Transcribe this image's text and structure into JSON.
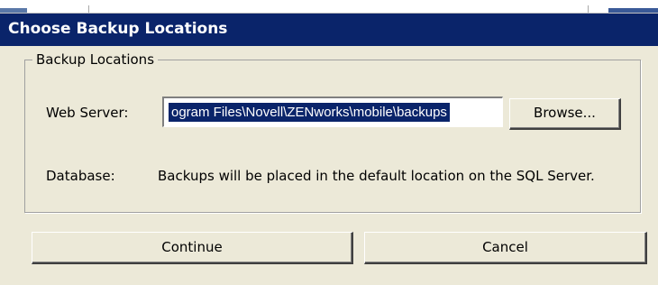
{
  "window": {
    "title": "Choose Backup Locations"
  },
  "group": {
    "legend": "Backup Locations",
    "web_server": {
      "label": "Web Server:",
      "value": "ogram Files\\Novell\\ZENworks\\mobile\\backups",
      "browse_label": "Browse..."
    },
    "database": {
      "label": "Database:",
      "message": "Backups will be placed in the default location on the SQL Server."
    }
  },
  "buttons": {
    "continue_label": "Continue",
    "cancel_label": "Cancel"
  },
  "colors": {
    "titlebar": "#0a246a",
    "dialog_bg": "#ece9d8",
    "selection": "#0a246a"
  }
}
